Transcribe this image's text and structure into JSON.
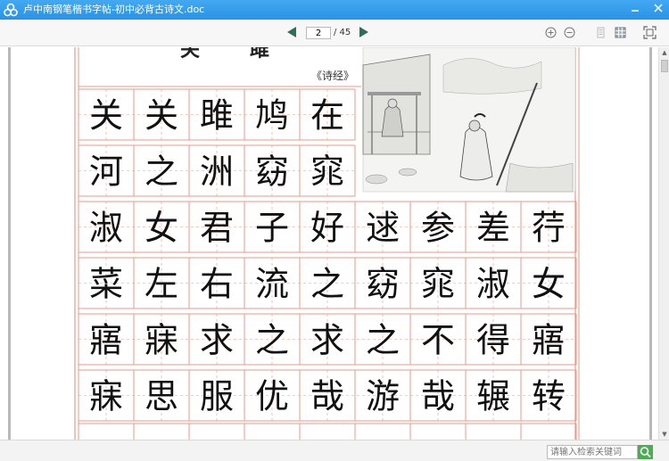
{
  "window": {
    "title": "卢中南钢笔楷书字帖-初中必背古诗文.doc",
    "controls": [
      "minimize",
      "close"
    ]
  },
  "toolbar": {
    "current_page": "2",
    "total_pages": "/ 45",
    "icons": [
      "zoom-in-icon",
      "zoom-out-icon",
      "single-page-icon",
      "thumbnail-grid-icon",
      "fullscreen-icon"
    ]
  },
  "document": {
    "heading_left": "关",
    "heading_right": "雎",
    "source": "《诗经》",
    "rows": [
      [
        "关",
        "关",
        "雎",
        "鸠",
        "在"
      ],
      [
        "河",
        "之",
        "洲",
        "窈",
        "窕"
      ],
      [
        "淑",
        "女",
        "君",
        "子",
        "好",
        "逑",
        "参",
        "差",
        "荇"
      ],
      [
        "菜",
        "左",
        "右",
        "流",
        "之",
        "窈",
        "窕",
        "淑",
        "女"
      ],
      [
        "寤",
        "寐",
        "求",
        "之",
        "求",
        "之",
        "不",
        "得",
        "寤"
      ],
      [
        "寐",
        "思",
        "服",
        "优",
        "哉",
        "游",
        "哉",
        "辗",
        "转"
      ]
    ]
  },
  "search": {
    "placeholder": "请输入检索关键词"
  },
  "colors": {
    "titlebar": "#2a93e6",
    "grid_line": "#e8998a",
    "ink": "#111111",
    "search_button": "#4cae52"
  }
}
